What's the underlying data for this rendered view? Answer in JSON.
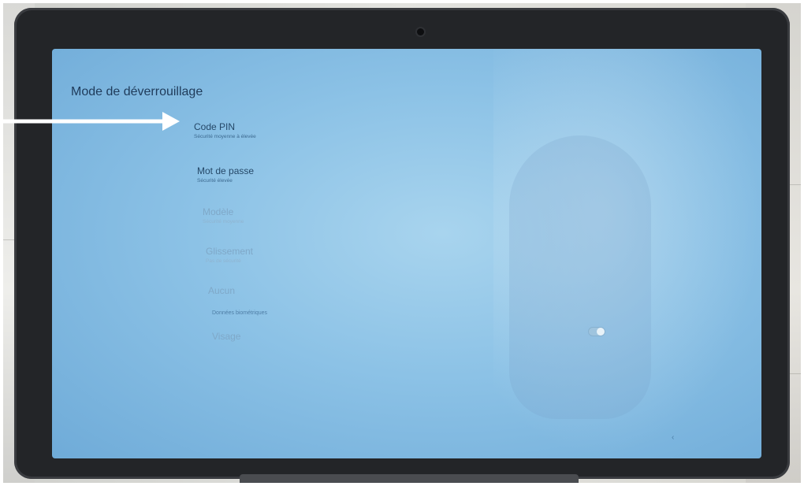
{
  "screen": {
    "title": "Mode de déverrouillage",
    "options": [
      {
        "label": "Code PIN",
        "description": "Sécurité moyenne à élevée"
      },
      {
        "label": "Mot de passe",
        "description": "Sécurité élevée"
      },
      {
        "label": "Modèle",
        "description": "Sécurité moyenne"
      },
      {
        "label": "Glissement",
        "description": "Pas de sécurité"
      },
      {
        "label": "Aucun"
      }
    ],
    "biometrics_header": "Données biométriques",
    "face_option": {
      "label": "Visage"
    },
    "face_toggle_on": false
  },
  "annotation": {
    "arrow_color": "#ffffff",
    "points_to": "Code PIN"
  },
  "colors": {
    "screen": "#8cc2e6",
    "bezel": "#232528",
    "text": "#254868"
  }
}
